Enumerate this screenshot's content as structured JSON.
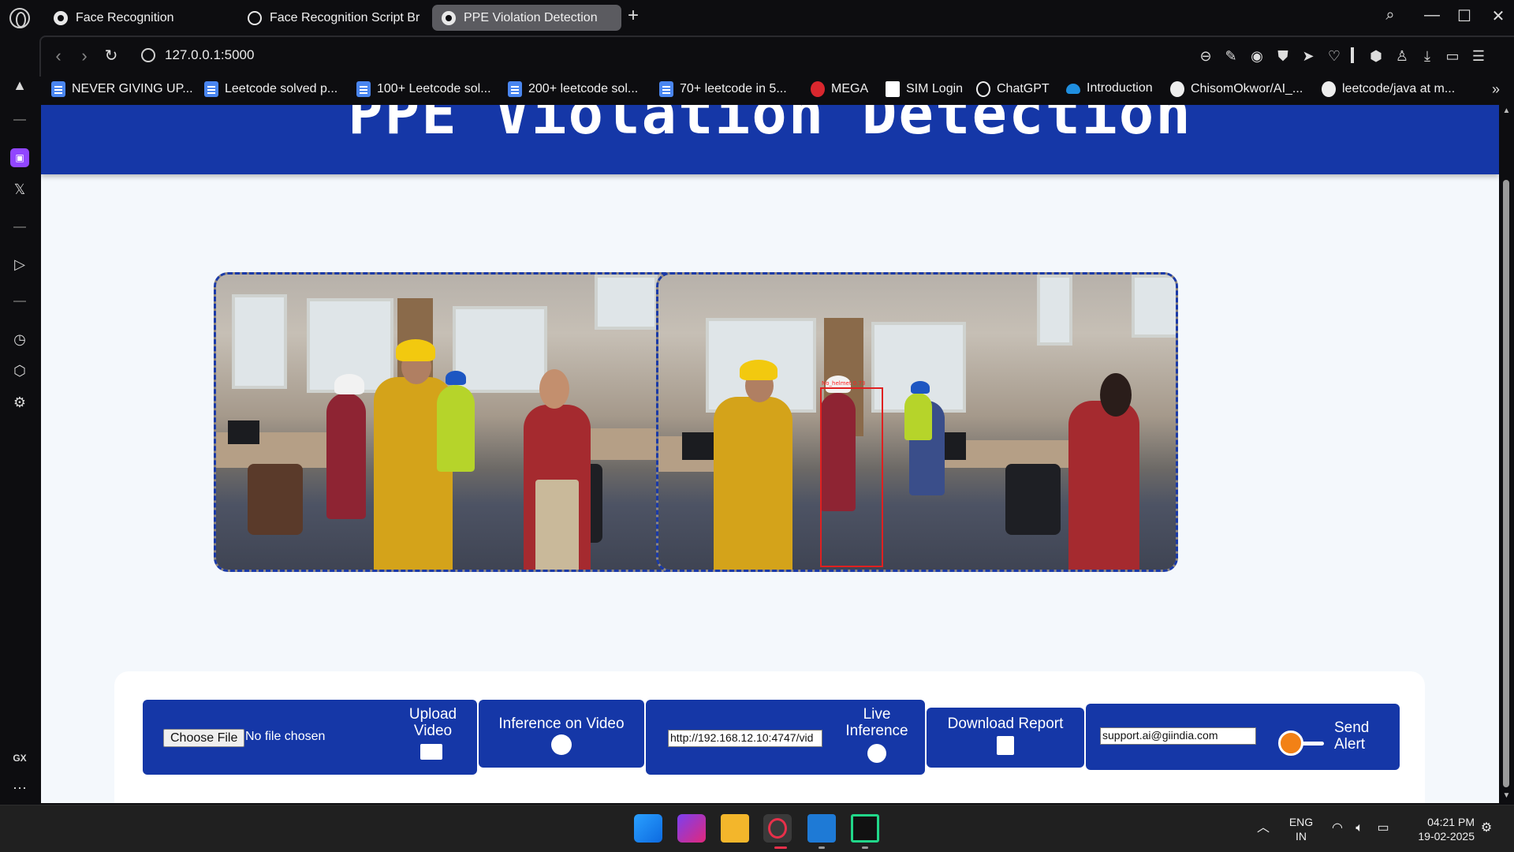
{
  "browser": {
    "tabs": [
      {
        "label": "Face Recognition"
      },
      {
        "label": "Face Recognition Script Br"
      },
      {
        "label": "PPE Violation Detection"
      }
    ],
    "url": "127.0.0.1:5000",
    "bookmarks": [
      {
        "label": "NEVER GIVING UP...",
        "icon": "doc-icon"
      },
      {
        "label": "Leetcode solved p...",
        "icon": "doc-icon"
      },
      {
        "label": "100+ Leetcode sol...",
        "icon": "doc-icon"
      },
      {
        "label": "200+ leetcode sol...",
        "icon": "doc-icon"
      },
      {
        "label": "70+ leetcode in 5...",
        "icon": "doc-icon"
      },
      {
        "label": "MEGA",
        "icon": "mega-icon"
      },
      {
        "label": "SIM Login",
        "icon": "file-icon"
      },
      {
        "label": "ChatGPT",
        "icon": "chatgpt-icon"
      },
      {
        "label": "Introduction",
        "icon": "cloud-icon"
      },
      {
        "label": "ChisomOkwor/AI_...",
        "icon": "github-icon"
      },
      {
        "label": "leetcode/java at m...",
        "icon": "github-icon"
      }
    ],
    "sidebar_label": "GX"
  },
  "page": {
    "header_title": "PPE Violation Detection",
    "detection_label": "No_helmet 0.73",
    "controls": {
      "choose_file": "Choose File",
      "no_file": "No file chosen",
      "upload_line1": "Upload",
      "upload_line2": "Video",
      "inference_video": "Inference on Video",
      "stream_url": "http://192.168.12.10:4747/vid",
      "live_line1": "Live",
      "live_line2": "Inference",
      "download_report": "Download Report",
      "alert_email": "support.ai@giindia.com",
      "send_line1": "Send",
      "send_line2": "Alert"
    },
    "colors": {
      "primary": "#1537a7",
      "background": "#f4f8fc",
      "toggle": "#f28116",
      "detection_box": "#e02020"
    }
  },
  "taskbar": {
    "lang_line1": "ENG",
    "lang_line2": "IN",
    "time": "04:21 PM",
    "date": "19-02-2025"
  }
}
